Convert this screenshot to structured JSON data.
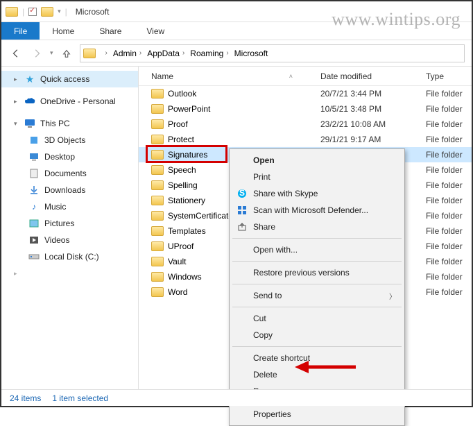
{
  "window": {
    "title": "Microsoft"
  },
  "ribbon": {
    "file": "File",
    "home": "Home",
    "share": "Share",
    "view": "View"
  },
  "breadcrumbs": [
    "Admin",
    "AppData",
    "Roaming",
    "Microsoft"
  ],
  "sidebar": {
    "quick_access": "Quick access",
    "onedrive": "OneDrive - Personal",
    "this_pc": "This PC",
    "items": [
      {
        "label": "3D Objects"
      },
      {
        "label": "Desktop"
      },
      {
        "label": "Documents"
      },
      {
        "label": "Downloads"
      },
      {
        "label": "Music"
      },
      {
        "label": "Pictures"
      },
      {
        "label": "Videos"
      },
      {
        "label": "Local Disk (C:)"
      }
    ]
  },
  "columns": {
    "name": "Name",
    "date": "Date modified",
    "type": "Type"
  },
  "files": [
    {
      "name": "Outlook",
      "date": "20/7/21 3:44 PM",
      "type": "File folder"
    },
    {
      "name": "PowerPoint",
      "date": "10/5/21 3:48 PM",
      "type": "File folder"
    },
    {
      "name": "Proof",
      "date": "23/2/21 10:08 AM",
      "type": "File folder"
    },
    {
      "name": "Protect",
      "date": "29/1/21 9:17 AM",
      "type": "File folder"
    },
    {
      "name": "Signatures",
      "date": "",
      "type": "File folder"
    },
    {
      "name": "Speech",
      "date": "",
      "type": "File folder"
    },
    {
      "name": "Spelling",
      "date": "",
      "type": "File folder"
    },
    {
      "name": "Stationery",
      "date": "",
      "type": "File folder"
    },
    {
      "name": "SystemCertificates",
      "date": "",
      "type": "File folder"
    },
    {
      "name": "Templates",
      "date": "",
      "type": "File folder"
    },
    {
      "name": "UProof",
      "date": "",
      "type": "File folder"
    },
    {
      "name": "Vault",
      "date": "",
      "type": "File folder"
    },
    {
      "name": "Windows",
      "date": "",
      "type": "File folder"
    },
    {
      "name": "Word",
      "date": "",
      "type": "File folder"
    }
  ],
  "selected_index": 4,
  "context_menu": {
    "open": "Open",
    "print": "Print",
    "skype": "Share with Skype",
    "defender": "Scan with Microsoft Defender...",
    "share": "Share",
    "open_with": "Open with...",
    "restore": "Restore previous versions",
    "send_to": "Send to",
    "cut": "Cut",
    "copy": "Copy",
    "create_shortcut": "Create shortcut",
    "delete": "Delete",
    "rename": "Rename",
    "properties": "Properties"
  },
  "statusbar": {
    "count": "24 items",
    "selection": "1 item selected"
  },
  "watermark": "www.wintips.org"
}
